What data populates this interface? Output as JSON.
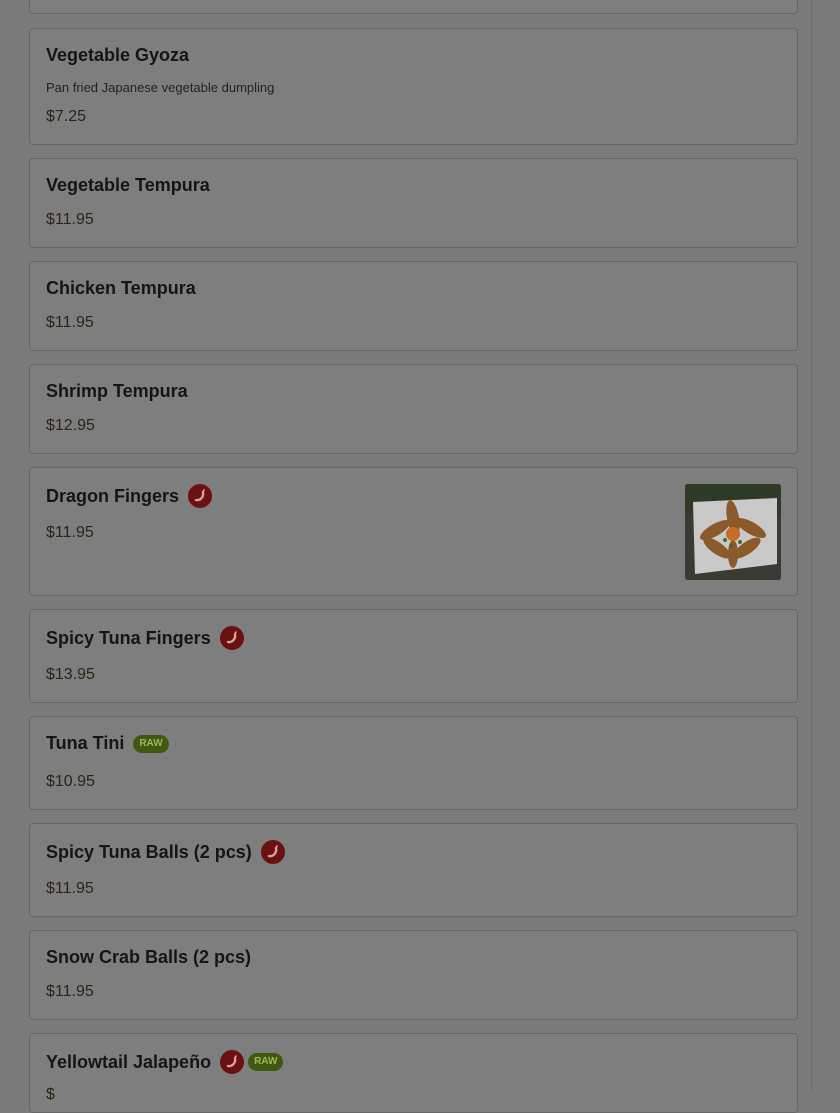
{
  "items": [
    {
      "name": "Vegetable Gyoza",
      "description": "Pan fried Japanese vegetable dumpling",
      "price": "$7.25"
    },
    {
      "name": "Vegetable Tempura",
      "price": "$11.95"
    },
    {
      "name": "Chicken Tempura",
      "price": "$11.95"
    },
    {
      "name": "Shrimp Tempura",
      "price": "$12.95"
    },
    {
      "name": "Dragon Fingers",
      "price": "$11.95",
      "spicy": true,
      "has_photo": true
    },
    {
      "name": "Spicy Tuna Fingers",
      "price": "$13.95",
      "spicy": true
    },
    {
      "name": "Tuna Tini",
      "price": "$10.95",
      "badge": "RAW"
    },
    {
      "name": "Spicy Tuna Balls (2 pcs)",
      "price": "$11.95",
      "spicy": true
    },
    {
      "name": "Snow Crab Balls (2 pcs)",
      "price": "$11.95"
    },
    {
      "name": "Yellowtail Jalapeño",
      "price": "$",
      "spicy": true,
      "badge": "RAW"
    }
  ],
  "icons": {
    "spicy": "chili-pepper-icon",
    "photo": "dish-photo"
  },
  "colors": {
    "spicy_badge": "#6a1212",
    "raw_badge": "#3f5a10",
    "raw_text": "#9bb560"
  }
}
